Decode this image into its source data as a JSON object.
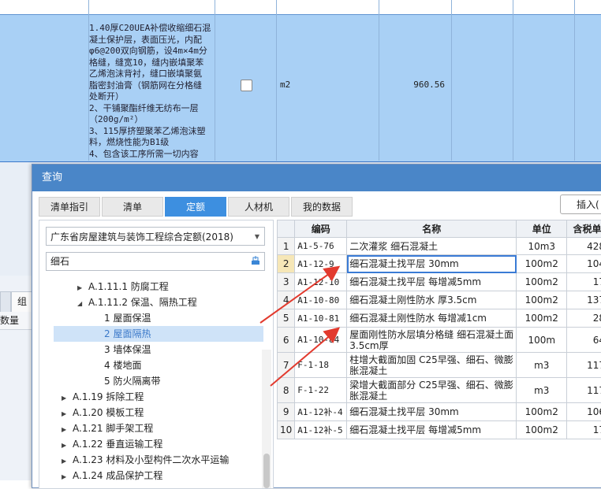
{
  "sheet": {
    "description": "1.40厚C20UEA补偿收缩细石混\n凝土保护层，表面压光，内配\nφ6@200双向钢筋，设4m×4m分\n格缝，缝宽10，缝内嵌填聚苯\n乙烯泡沫背衬，缝口嵌填聚氨\n脂密封油膏（钢筋网在分格缝\n处断开）\n2、干铺聚酯纤维无纺布一层\n（200g/m²）\n3、115厚挤塑聚苯乙烯泡沫塑\n料，燃烧性能为B1级\n4、包含该工序所需一切内容",
    "unit": "m2",
    "quantity": "960.56",
    "bottom_tab": "组",
    "bottom_col": "数量"
  },
  "dialog": {
    "title": "查询",
    "tabs": [
      {
        "label": "清单指引"
      },
      {
        "label": "清单"
      },
      {
        "label": "定额",
        "active": true
      },
      {
        "label": "人材机"
      },
      {
        "label": "我的数据"
      }
    ],
    "insert_label": "插入(",
    "library": "广东省房屋建筑与装饰工程综合定额(2018)",
    "search_value": "细石",
    "tree": [
      {
        "label": "A.1.11.1 防腐工程",
        "arrow": "▶"
      },
      {
        "label": "A.1.11.2 保温、隔热工程",
        "arrow": "◢"
      },
      {
        "label": "1 屋面保温"
      },
      {
        "label": "2 屋面隔热",
        "highlight": true
      },
      {
        "label": "3 墙体保温"
      },
      {
        "label": "4 楼地面"
      },
      {
        "label": "5 防火隔离带"
      },
      {
        "label": "A.1.19 拆除工程",
        "arrow": "▶"
      },
      {
        "label": "A.1.20 模板工程",
        "arrow": "▶"
      },
      {
        "label": "A.1.21 脚手架工程",
        "arrow": "▶"
      },
      {
        "label": "A.1.22 垂直运输工程",
        "arrow": "▶"
      },
      {
        "label": "A.1.23 材料及小型构件二次水平运输",
        "arrow": "▶"
      },
      {
        "label": "A.1.24 成品保护工程",
        "arrow": "▶"
      }
    ],
    "grid": {
      "headers": [
        "",
        "编码",
        "名称",
        "单位",
        "含税单"
      ],
      "rows": [
        {
          "idx": "1",
          "code": "A1-5-76",
          "name": "二次灌浆 细石混凝土",
          "unit": "10m3",
          "price": "428"
        },
        {
          "idx": "2",
          "code": "A1-12-9",
          "name": "细石混凝土找平层 30mm",
          "unit": "100m2",
          "price": "104",
          "current": true
        },
        {
          "idx": "3",
          "code": "A1-12-10",
          "name": "细石混凝土找平层 每增减5mm",
          "unit": "100m2",
          "price": "17"
        },
        {
          "idx": "4",
          "code": "A1-10-80",
          "name": "细石混凝土刚性防水 厚3.5cm",
          "unit": "100m2",
          "price": "137"
        },
        {
          "idx": "5",
          "code": "A1-10-81",
          "name": "细石混凝土刚性防水 每增减1cm",
          "unit": "100m2",
          "price": "28"
        },
        {
          "idx": "6",
          "code": "A1-10-84",
          "name": "屋面刚性防水层填分格缝 细石混凝土面3.5cm厚",
          "unit": "100m",
          "price": "64",
          "tall": true
        },
        {
          "idx": "7",
          "code": "F-1-18",
          "name": "柱增大截面加固 C25早强、细石、微膨胀混凝土",
          "unit": "m3",
          "price": "117",
          "tall": true
        },
        {
          "idx": "8",
          "code": "F-1-22",
          "name": "梁增大截面部分 C25早强、细石、微膨胀混凝土",
          "unit": "m3",
          "price": "117",
          "tall": true
        },
        {
          "idx": "9",
          "code": "A1-12补-4",
          "name": "细石混凝土找平层 30mm",
          "unit": "100m2",
          "price": "106"
        },
        {
          "idx": "10",
          "code": "A1-12补-5",
          "name": "细石混凝土找平层 每增减5mm",
          "unit": "100m2",
          "price": "17"
        }
      ]
    }
  },
  "colors": {
    "title_bar": "#4a86c8",
    "active_tab": "#3d8fe0",
    "arrow": "#e23a2e",
    "selected_row": "#a9d0f5"
  }
}
